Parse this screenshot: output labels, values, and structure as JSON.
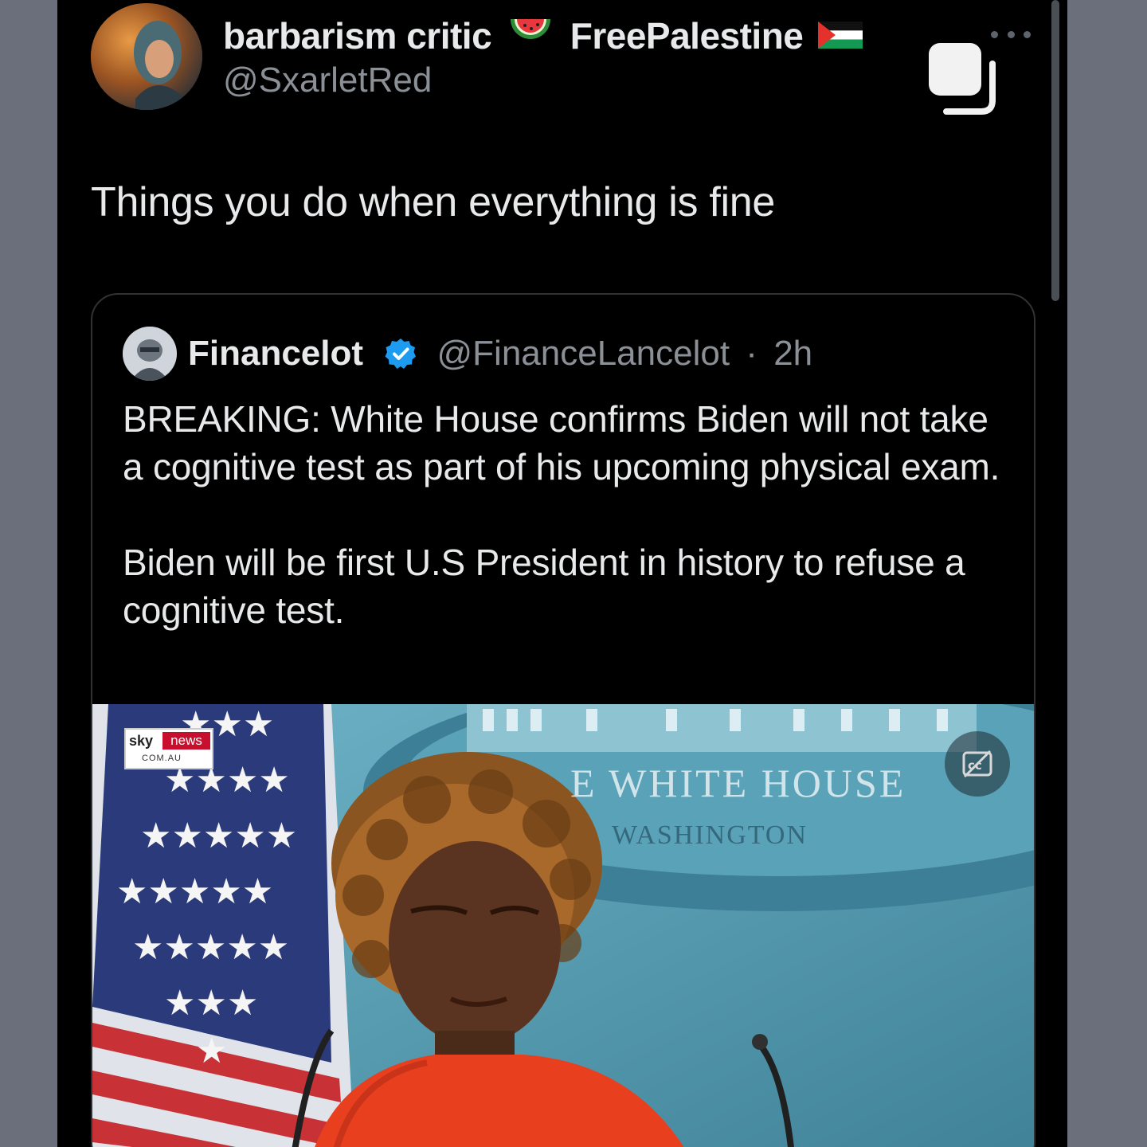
{
  "post": {
    "display_name_part1": "barbarism critic",
    "display_name_part2": "FreePalestine",
    "name_emoji_1": "watermelon-icon",
    "name_emoji_2": "palestine-flag-icon",
    "handle": "@SxarletRed",
    "text": "Things you do when everything is fine"
  },
  "quoted": {
    "name": "Financelot",
    "handle": "@FinanceLancelot",
    "separator": "·",
    "time": "2h",
    "verified": true,
    "paragraph_1": "BREAKING: White House confirms Biden will not take a cognitive test as part of his upcoming physical exam.",
    "paragraph_2": "Biden will be first U.S President in history to refuse a cognitive test."
  },
  "media": {
    "logo_sky": "sky",
    "logo_news": "news",
    "logo_domain": "COM.AU",
    "backdrop_title": "E WHITE HOUSE",
    "backdrop_subtitle": "WASHINGTON",
    "captions_icon": "cc-icon"
  },
  "colors": {
    "background": "#000000",
    "text_primary": "#e7e9ea",
    "text_secondary": "#8b9097",
    "verified": "#1d9bf0",
    "outer_frame": "#6b6f7b"
  }
}
